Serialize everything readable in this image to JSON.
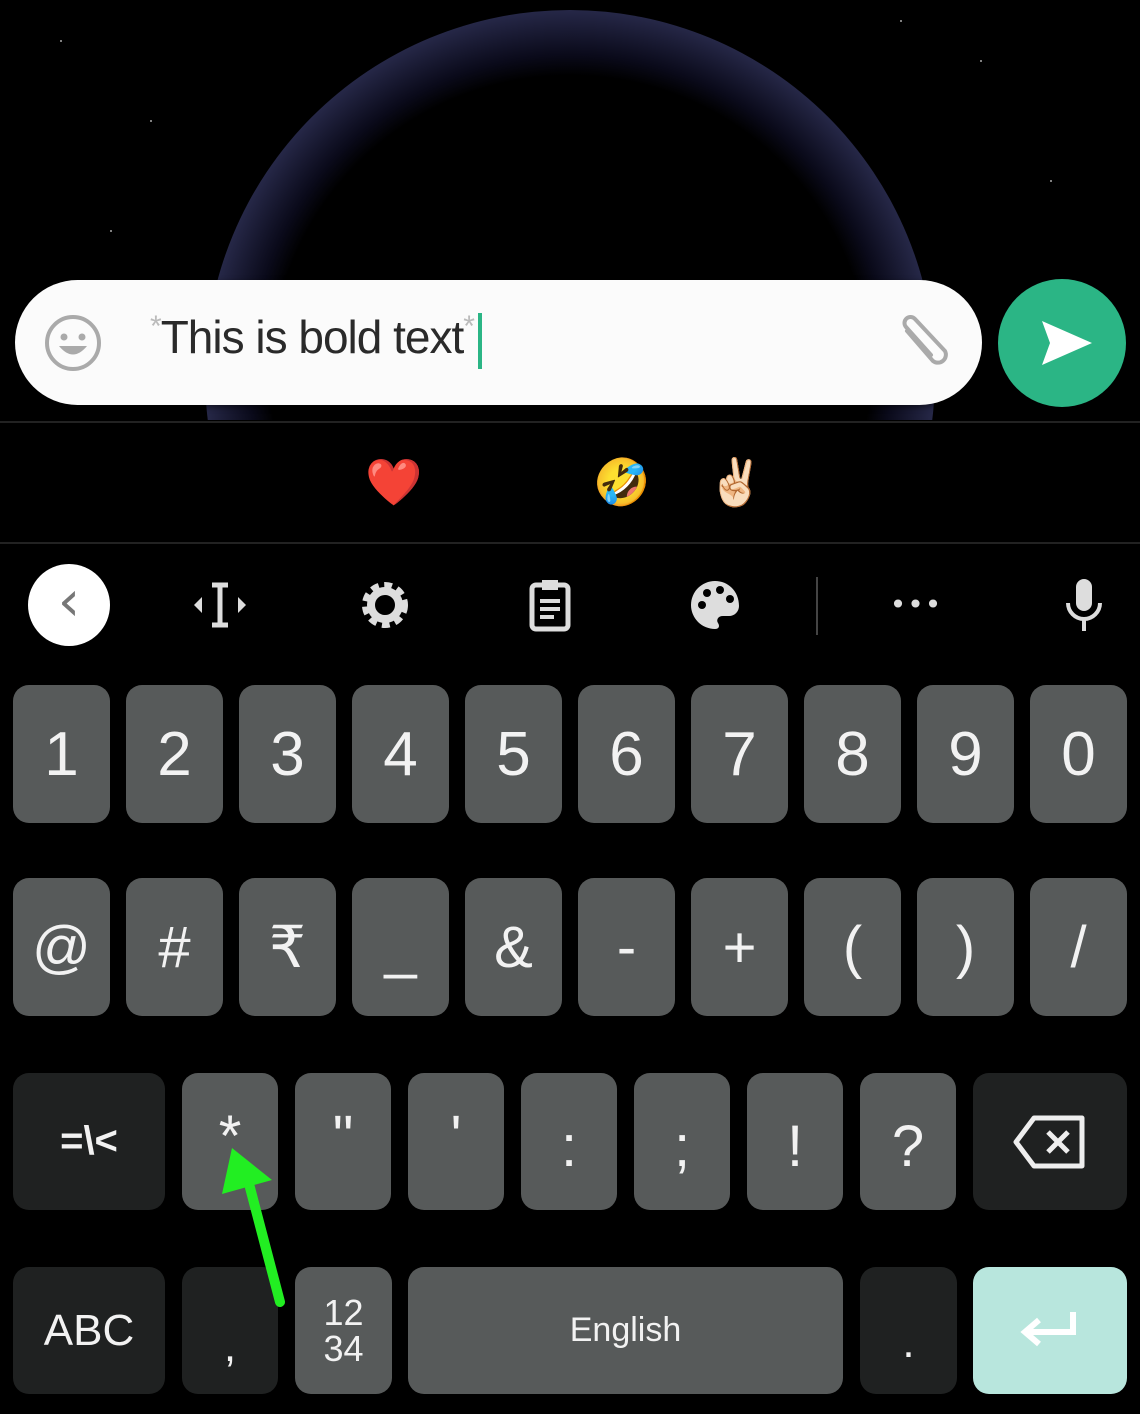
{
  "message_input": {
    "value": "*This is bold text*",
    "asterisk": "*",
    "bold_text": "This is bold text"
  },
  "icons": {
    "emoji_button": "smiley-face-icon",
    "attach": "paperclip-icon",
    "send": "send-arrow-icon"
  },
  "colors": {
    "accent": "#2bb585",
    "key": "#575a5a",
    "key_dark": "#1f2121",
    "enter": "#b8e6dd",
    "annotation_arrow": "#22ee22"
  },
  "emoji_suggestions": [
    "😂",
    "😘",
    "😀",
    "❤️",
    "😭",
    "🤣",
    "✌🏻",
    "😵",
    "😌",
    "😍"
  ],
  "toolbar": {
    "back": "‹",
    "items": [
      "cursor-move-icon",
      "settings-gear-icon",
      "clipboard-icon",
      "theme-palette-icon",
      "more-dots-icon",
      "microphone-icon"
    ],
    "more": "•••"
  },
  "keyboard": {
    "row1": [
      "1",
      "2",
      "3",
      "4",
      "5",
      "6",
      "7",
      "8",
      "9",
      "0"
    ],
    "row2": [
      "@",
      "#",
      "₹",
      "_",
      "&",
      "-",
      "+",
      "(",
      ")",
      "/"
    ],
    "row3": [
      "=\\<",
      "*",
      "\"",
      "'",
      ":",
      ";",
      "!",
      "?"
    ],
    "row4": {
      "abc": "ABC",
      "comma": ",",
      "numpad_top": "12",
      "numpad_bottom": "34",
      "space": "English",
      "period": "."
    }
  }
}
